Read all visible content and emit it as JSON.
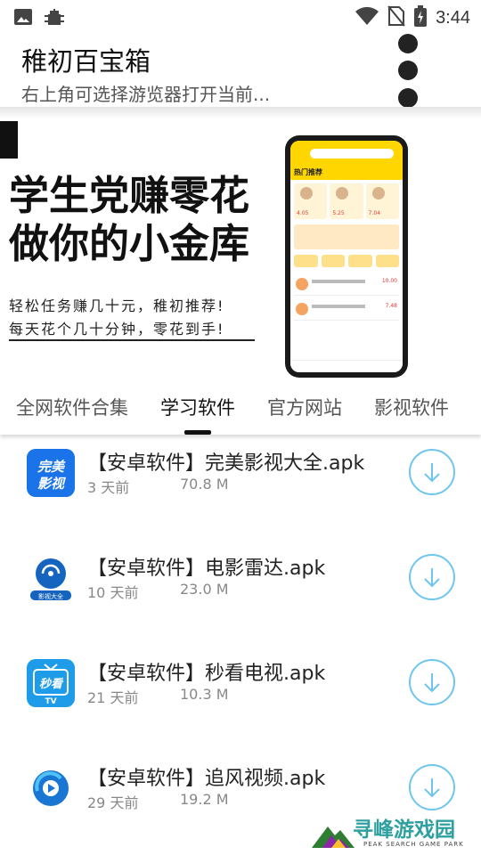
{
  "status_bar": {
    "time": "3:44",
    "left_icons": [
      "image-icon",
      "bug-icon"
    ],
    "right_icons": [
      "wifi-icon",
      "no-sim-icon",
      "battery-charging-icon"
    ]
  },
  "app_bar": {
    "title": "稚初百宝箱",
    "subtitle": "右上角可选择游览器打开当前...",
    "overflow_icon": "more-vertical-icon"
  },
  "banner": {
    "headline_1": "学生党赚零花",
    "headline_2": "做你的小金库",
    "sub_1": "轻松任务赚几十元，稚初推荐!",
    "sub_2": "每天花个几十分钟，零花到手!",
    "phone": {
      "section_label": "热门推荐",
      "card_prices": [
        "4.05",
        "5.25",
        "7.04"
      ],
      "row_prices": [
        "10.00",
        "7.48"
      ]
    }
  },
  "tabs": [
    {
      "label": "全网软件合集",
      "active": false
    },
    {
      "label": "学习软件",
      "active": true
    },
    {
      "label": "官方网站",
      "active": false
    },
    {
      "label": "影视软件",
      "active": false
    }
  ],
  "items": [
    {
      "title": "【安卓软件】完美影视大全.apk",
      "age": "3 天前",
      "size": "70.8 M",
      "icon": "wanmei-yingshi-app-icon",
      "icon_text": "完美影视"
    },
    {
      "title": "【安卓软件】电影雷达.apk",
      "age": "10 天前",
      "size": "23.0 M",
      "icon": "radar-app-icon",
      "icon_text": "影视大全"
    },
    {
      "title": "【安卓软件】秒看电视.apk",
      "age": "21 天前",
      "size": "10.3 M",
      "icon": "tv-app-icon",
      "icon_text": "秒看"
    },
    {
      "title": "【安卓软件】追风视频.apk",
      "age": "29 天前",
      "size": "19.2 M",
      "icon": "zhuifeng-app-icon",
      "icon_text": ""
    }
  ],
  "watermark": {
    "title": "寻峰游戏园",
    "subtitle": "PEAK SEARCH GAME PARK"
  },
  "colors": {
    "accent_download": "#6ec6ee",
    "phone_yellow": "#ffd600",
    "watermark": "#2ea0a0"
  }
}
